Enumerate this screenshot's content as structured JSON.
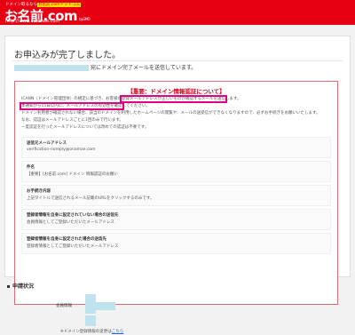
{
  "brand": {
    "tagline_prefix": "ドメイン取るなら",
    "tagline_highlight": "お名前.comドットコム",
    "logo": "お名前.com",
    "logo_suffix": "byGMO",
    "url": "http://www.onamae.com"
  },
  "page": {
    "title": "お申込みが完了しました。",
    "sent_message": "宛にドメイン完了メールを送信しています。"
  },
  "notice": {
    "title": "【重要：ドメイン情報認証について】",
    "lines": [
      {
        "before": "ICANN（ドメイン管理団体）の規定に基づき、お客様の",
        "highlight": "登録メールアドレスが正しいものか確認するメールを送信",
        "after": "します。"
      },
      {
        "before": "",
        "highlight": "本通知から15日以内に、メールアドレスの有効性を確認",
        "after": "してください。"
      },
      {
        "before": "ドメイン利用者が確認されない場合、該当のドメインを利用したホームページの閲覧や、メールの送受信ができなくなりますので、必ずお手続きをお願いいたします。",
        "highlight": "",
        "after": ""
      },
      {
        "before": "なお、認証はメールアドレスごとに1回のみで行います。",
        "highlight": "",
        "after": ""
      },
      {
        "before": "一度認証を行ったメールアドレスについては改めての認証は不要です。",
        "highlight": "",
        "after": ""
      }
    ]
  },
  "fields": [
    {
      "label": "送信元メールアドレス",
      "value": "verification-noreply@onamae.com"
    },
    {
      "label": "件名",
      "value": "【重要】[お名前.com] ドメイン 情報認証のお願い"
    },
    {
      "label": "お手続き内容",
      "value": "上記タイトルで送信されるメール記載のURLをクリックするのみです。"
    },
    {
      "label": "登録者情報を自身に設定されていない場合の送信先",
      "value": "会員情報としてご登録いただいたメールアドレス"
    },
    {
      "label": "登録者情報を自身に設定された場合の送信先",
      "value": "登録者情報としてご登録いただいたメールアドレス"
    }
  ],
  "status": {
    "title": "申請状況",
    "member_label": "会員情報",
    "note_text": "※ドメイン登録情報の変更は",
    "note_link": "こちら"
  },
  "colors": {
    "brand_red": "#e60012",
    "notice_border": "#e06b73",
    "highlight_border": "#e4007f",
    "redaction": "#bfe3ee"
  }
}
